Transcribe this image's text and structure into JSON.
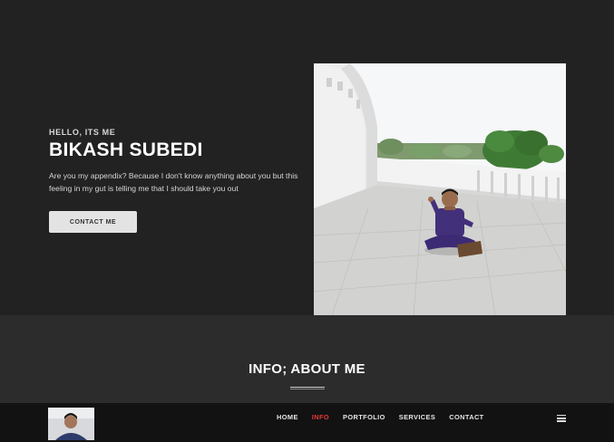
{
  "hero": {
    "greeting": "HELLO, ITS ME",
    "name": "BIKASH SUBEDI",
    "tagline": "Are you my appendix? Because I don't know anything about you but this feeling in my gut is telling me that I should take you out",
    "contact_button": "CONTACT ME",
    "photo_icon": "profile-photo"
  },
  "info": {
    "title": "INFO; ABOUT ME"
  },
  "nav": {
    "avatar_icon": "avatar-photo",
    "links": [
      {
        "label": "HOME",
        "active": false
      },
      {
        "label": "INFO",
        "active": true
      },
      {
        "label": "PORTFOLIO",
        "active": false
      },
      {
        "label": "SERVICES",
        "active": false
      },
      {
        "label": "CONTACT",
        "active": false
      }
    ],
    "menu_icon": "hamburger-menu-icon"
  },
  "colors": {
    "background": "#222222",
    "info_band": "#2c2c2c",
    "navbar": "#121212",
    "active_link": "#e53935",
    "button": "#e3e3e3"
  }
}
